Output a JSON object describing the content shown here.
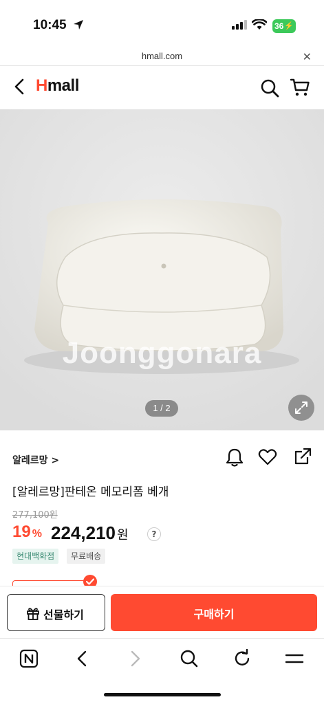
{
  "status_bar": {
    "time": "10:45",
    "battery": "36"
  },
  "browser": {
    "url": "hmall.com"
  },
  "header": {
    "logo_h": "H",
    "logo_mall": "mall"
  },
  "product": {
    "watermark": "Joonggonara",
    "image_counter": "1 / 2",
    "brand": "알레르망 >",
    "title": "[알레르망]판테온 메모리폼 베개",
    "original_price": "277,100원",
    "discount_rate": "19",
    "discount_unit": "%",
    "price": "224,210",
    "price_unit": "원",
    "help_mark": "?",
    "badges": [
      "현대백화점",
      "무료배송"
    ]
  },
  "actions": {
    "gift_label": "선물하기",
    "buy_label": "구매하기"
  },
  "colors": {
    "accent": "#ff4a31",
    "badge_green": "#3a8a72"
  }
}
